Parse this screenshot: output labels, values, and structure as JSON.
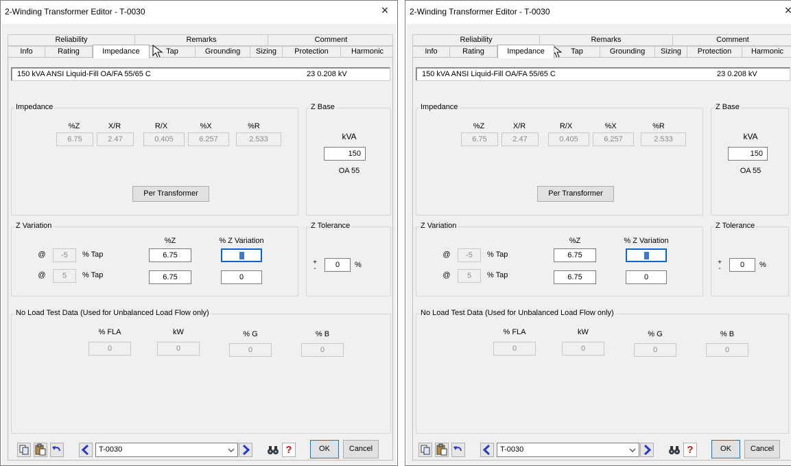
{
  "window": {
    "title": "2-Winding Transformer Editor - T-0030",
    "close_glyph": "×"
  },
  "tabs": {
    "top_row": [
      "Reliability",
      "Remarks",
      "Comment"
    ],
    "bottom_row": [
      "Info",
      "Rating",
      "Impedance",
      "Tap",
      "Grounding",
      "Sizing",
      "Protection",
      "Harmonic"
    ],
    "selected": "Impedance"
  },
  "info": {
    "rating": "150 kVA  ANSI  Liquid-Fill  OA/FA  55/65 C",
    "voltage": "23   0.208 kV"
  },
  "impedance": {
    "group_label": "Impedance",
    "headers": [
      "%Z",
      "X/R",
      "R/X",
      "%X",
      "%R"
    ],
    "values": [
      "6.75",
      "2.47",
      "0.405",
      "6.257",
      "2.533"
    ],
    "per_button": "Per Transformer"
  },
  "zbase": {
    "group_label": "Z Base",
    "unit": "kVA",
    "value": "150",
    "note": "OA 55"
  },
  "zvariation": {
    "group_label": "Z Variation",
    "col_z": "%Z",
    "col_var": "% Z Variation",
    "at": "@",
    "tap_label": "% Tap",
    "rows": [
      {
        "tap": "-5",
        "z": "6.75",
        "variation": "0"
      },
      {
        "tap": "5",
        "z": "6.75",
        "variation": "0"
      }
    ]
  },
  "ztolerance": {
    "group_label": "Z Tolerance",
    "plus": "+",
    "minus": "-",
    "value": "0",
    "unit": "%"
  },
  "noload": {
    "group_label": "No Load Test Data (Used for Unbalanced Load Flow only)",
    "headers": [
      "% FLA",
      "kW",
      "% G",
      "% B"
    ],
    "values": [
      "0",
      "0",
      "0",
      "0"
    ]
  },
  "bottom": {
    "id_value": "T-0030",
    "ok": "OK",
    "cancel": "Cancel",
    "help": "?"
  },
  "colors": {
    "focus_border": "#0a64c8",
    "nav_arrow": "#2a35c9",
    "help_red": "#d01010"
  },
  "icons": [
    "copy-icon",
    "paste-icon",
    "undo-icon",
    "prev-arrow-icon",
    "next-arrow-icon",
    "find-binoculars-icon",
    "help-icon",
    "dropdown-chevron-icon",
    "cursor-arrow-icon"
  ]
}
